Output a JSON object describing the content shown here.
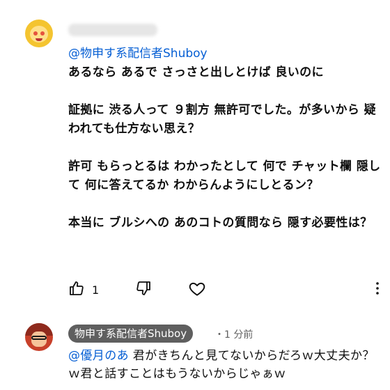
{
  "comment1": {
    "mention": "@物申す系配信者Shuboy",
    "body": "あるなら あるで さっさと出しとけば 良いのに\n\n証拠に 渋る人って ９割方 無許可でした。が多いから 疑われても仕方ない思え？\n\n許可 もらっとるは わかったとして 何で チャット欄 隠して 何に答えてるか わからんようにしとるン？\n\n本当に ブルシへの あのコトの質問なら 隠す必要性は？",
    "like_count": "1"
  },
  "comment2": {
    "author": "物申す系配信者Shuboy",
    "time": "・1 分前",
    "mention": "@優月のあ",
    "body": "  君がきちんと見てないからだろｗ大丈夫か？ｗ君と話すことはもうないからじゃぁｗ"
  },
  "icons": [
    "thumb-up-icon",
    "thumb-down-icon",
    "heart-icon",
    "more-vert-icon"
  ]
}
